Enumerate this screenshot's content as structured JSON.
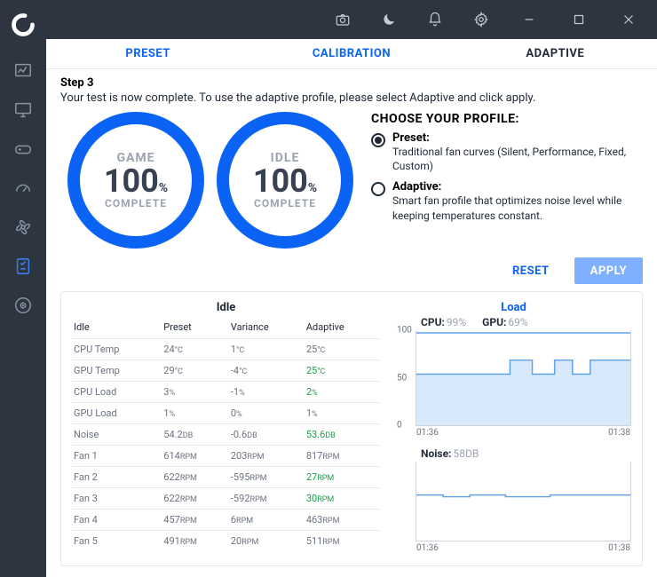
{
  "titlebar": {
    "icons": [
      "camera",
      "moon",
      "bell",
      "gear",
      "min",
      "max",
      "close"
    ]
  },
  "tabs": {
    "preset": "PRESET",
    "calibration": "CALIBRATION",
    "adaptive": "ADAPTIVE"
  },
  "step": {
    "label": "Step 3",
    "text": "Your test is now complete. To use the adaptive profile, please select Adaptive and click apply."
  },
  "gauges": {
    "game": {
      "title": "GAME",
      "value": "100",
      "pct": "%",
      "sub": "COMPLETE"
    },
    "idle": {
      "title": "IDLE",
      "value": "100",
      "pct": "%",
      "sub": "COMPLETE"
    }
  },
  "profile": {
    "title": "CHOOSE YOUR PROFILE:",
    "options": [
      {
        "label": "Preset:",
        "desc": "Traditional fan curves (Silent, Performance, Fixed, Custom)",
        "checked": true
      },
      {
        "label": "Adaptive:",
        "desc": "Smart fan profile that optimizes noise level while keeping temperatures constant.",
        "checked": false
      }
    ]
  },
  "buttons": {
    "reset": "RESET",
    "apply": "APPLY"
  },
  "table": {
    "section": "Idle",
    "headers": [
      "Idle",
      "Preset",
      "Variance",
      "Adaptive"
    ],
    "rows": [
      {
        "name": "CPU Temp",
        "preset": "24",
        "preset_unit": "°C",
        "variance": "1",
        "variance_unit": "°C",
        "adaptive": "25",
        "adaptive_unit": "°C",
        "accent": false
      },
      {
        "name": "GPU Temp",
        "preset": "29",
        "preset_unit": "°C",
        "variance": "-4",
        "variance_unit": "°C",
        "adaptive": "25",
        "adaptive_unit": "°C",
        "accent": true
      },
      {
        "name": "CPU Load",
        "preset": "3",
        "preset_unit": "%",
        "variance": "-1",
        "variance_unit": "%",
        "adaptive": "2",
        "adaptive_unit": "%",
        "accent": true
      },
      {
        "name": "GPU Load",
        "preset": "1",
        "preset_unit": "%",
        "variance": "0",
        "variance_unit": "%",
        "adaptive": "1",
        "adaptive_unit": "%",
        "accent": false
      },
      {
        "name": "Noise",
        "preset": "54.2",
        "preset_unit": "DB",
        "variance": "-0.6",
        "variance_unit": "DB",
        "adaptive": "53.6",
        "adaptive_unit": "DB",
        "accent": true
      },
      {
        "name": "Fan 1",
        "preset": "614",
        "preset_unit": "RPM",
        "variance": "203",
        "variance_unit": "RPM",
        "adaptive": "817",
        "adaptive_unit": "RPM",
        "accent": false
      },
      {
        "name": "Fan 2",
        "preset": "622",
        "preset_unit": "RPM",
        "variance": "-595",
        "variance_unit": "RPM",
        "adaptive": "27",
        "adaptive_unit": "RPM",
        "accent": true
      },
      {
        "name": "Fan 3",
        "preset": "622",
        "preset_unit": "RPM",
        "variance": "-592",
        "variance_unit": "RPM",
        "adaptive": "30",
        "adaptive_unit": "RPM",
        "accent": true
      },
      {
        "name": "Fan 4",
        "preset": "457",
        "preset_unit": "RPM",
        "variance": "6",
        "variance_unit": "RPM",
        "adaptive": "463",
        "adaptive_unit": "RPM",
        "accent": false
      },
      {
        "name": "Fan 5",
        "preset": "491",
        "preset_unit": "RPM",
        "variance": "20",
        "variance_unit": "RPM",
        "adaptive": "511",
        "adaptive_unit": "RPM",
        "accent": false
      }
    ]
  },
  "charts": {
    "load": {
      "title": "Load",
      "cpu_label": "CPU:",
      "cpu_val": "99%",
      "gpu_label": "GPU:",
      "gpu_val": "69%",
      "yticks": [
        "100",
        "50",
        "0"
      ],
      "xticks": [
        "01:36",
        "01:38"
      ]
    },
    "noise": {
      "label": "Noise:",
      "val": "58DB",
      "xticks": [
        "01:36",
        "01:38"
      ]
    }
  },
  "chart_data": [
    {
      "type": "line",
      "title": "Load",
      "ylabel": "%",
      "ylim": [
        0,
        100
      ],
      "x_range": [
        "01:36",
        "01:38"
      ],
      "series": [
        {
          "name": "CPU",
          "y_approx": [
            99,
            99,
            99,
            99,
            99,
            99,
            99,
            99,
            99,
            99
          ]
        },
        {
          "name": "GPU",
          "y_approx": [
            55,
            55,
            55,
            55,
            70,
            55,
            70,
            55,
            70,
            70
          ]
        }
      ]
    },
    {
      "type": "line",
      "title": "Noise",
      "ylabel": "DB",
      "ylim": [
        0,
        100
      ],
      "x_range": [
        "01:36",
        "01:38"
      ],
      "series": [
        {
          "name": "Noise",
          "y_approx": [
            58,
            58,
            58,
            58,
            58,
            58,
            58,
            58,
            58,
            58
          ]
        }
      ]
    }
  ]
}
